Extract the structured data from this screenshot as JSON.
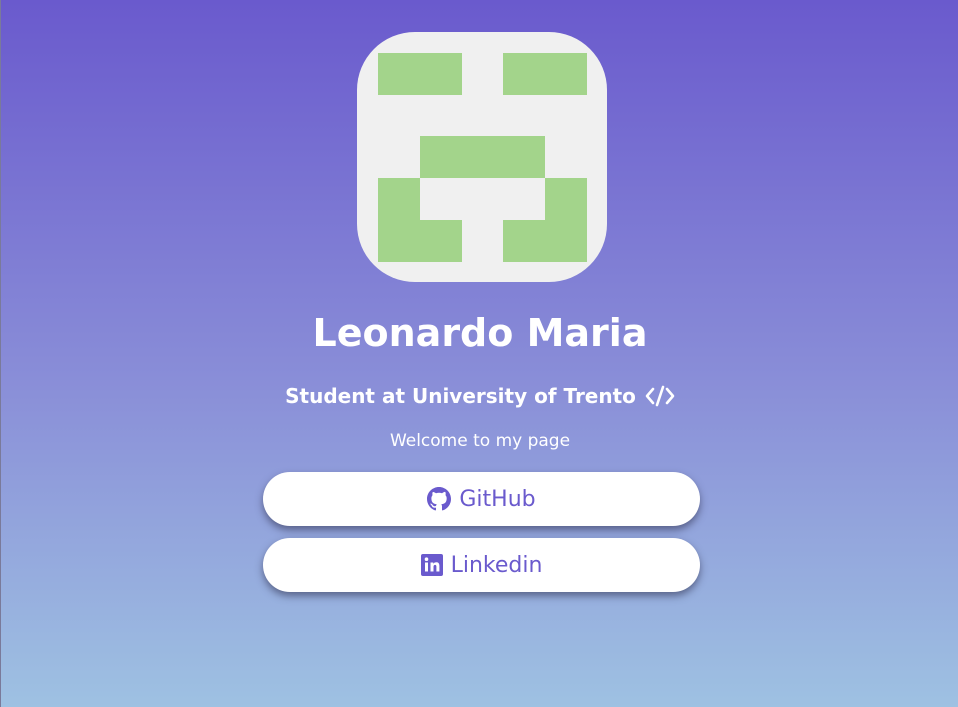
{
  "profile": {
    "name": "Leonardo Maria",
    "subtitle": "Student at University of Trento",
    "subtitle_icon": "code-icon",
    "welcome": "Welcome to my page",
    "avatar_icon": "identicon-avatar"
  },
  "links": {
    "github": {
      "label": "GitHub",
      "icon": "github-icon"
    },
    "linkedin": {
      "label": "Linkedin",
      "icon": "linkedin-icon"
    }
  },
  "colors": {
    "accent": "#6a5acd",
    "avatar_bg": "#f0f0f0",
    "avatar_fg": "#a3d48b",
    "gradient_top": "#6a5acd",
    "gradient_bottom": "#9ec1e2"
  }
}
